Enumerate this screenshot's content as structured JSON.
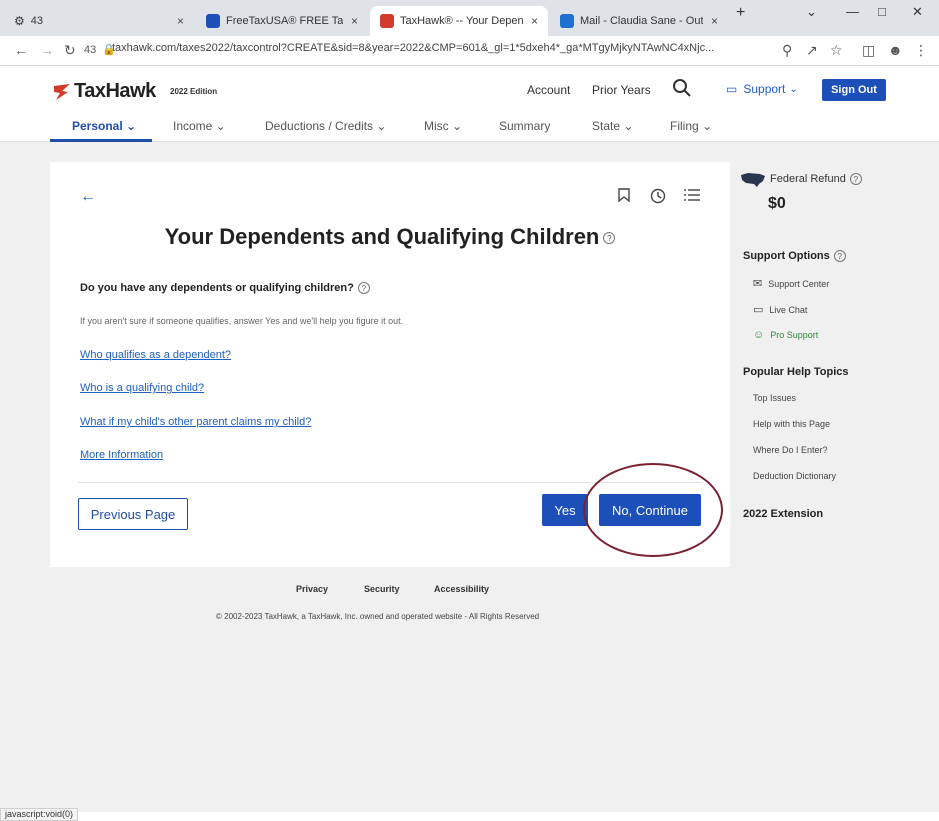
{
  "browser": {
    "tabs": [
      {
        "label": "43"
      },
      {
        "label": "FreeTaxUSA® FREE Tax Filing..."
      },
      {
        "label": "TaxHawk® -- Your Dependent..."
      },
      {
        "label": "Mail - Claudia Sane - Outlook"
      }
    ],
    "new_tab": "+",
    "url": "taxhawk.com/taxes2022/taxcontrol?CREATE&sid=8&year=2022&CMP=601&_gl=1*5dxeh4*_ga*MTgyMjkyNTAwNC4xNjc...",
    "reload_count": "43",
    "status": "javascript:void(0)"
  },
  "header": {
    "logo": "TaxHawk",
    "edition": "2022 Edition",
    "account": "Account",
    "prior_years": "Prior Years",
    "support": "Support",
    "sign_out": "Sign Out"
  },
  "nav": [
    {
      "label": "Personal ⌄"
    },
    {
      "label": "Income ⌄"
    },
    {
      "label": "Deductions / Credits ⌄"
    },
    {
      "label": "Misc ⌄"
    },
    {
      "label": "Summary"
    },
    {
      "label": "State ⌄"
    },
    {
      "label": "Filing ⌄"
    }
  ],
  "main": {
    "title": "Your Dependents and Qualifying Children",
    "question": "Do you have any dependents or qualifying children?",
    "hint": "If you aren't sure if someone qualifies, answer Yes and we'll help you figure it out.",
    "links": [
      "Who qualifies as a dependent?",
      "Who is a qualifying child?",
      "What if my child's other parent claims my child?",
      "More Information"
    ],
    "previous": "Previous Page",
    "yes": "Yes",
    "no_continue": "No, Continue"
  },
  "sidebar": {
    "refund_label": "Federal Refund",
    "refund_value": "$0",
    "support_heading": "Support Options",
    "support_items": [
      "Support Center",
      "Live Chat",
      "Pro Support"
    ],
    "help_heading": "Popular Help Topics",
    "help_items": [
      "Top Issues",
      "Help with this Page",
      "Where Do I Enter?",
      "Deduction Dictionary"
    ],
    "extension": "2022 Extension"
  },
  "footer": {
    "privacy": "Privacy",
    "security": "Security",
    "accessibility": "Accessibility",
    "copyright": "© 2002-2023 TaxHawk, a TaxHawk, Inc. owned and operated website - All Rights Reserved"
  },
  "colors": {
    "brand_blue": "#1d4fb8",
    "link_blue": "#1f5fbf",
    "annotation_circle": "#7a2231"
  }
}
